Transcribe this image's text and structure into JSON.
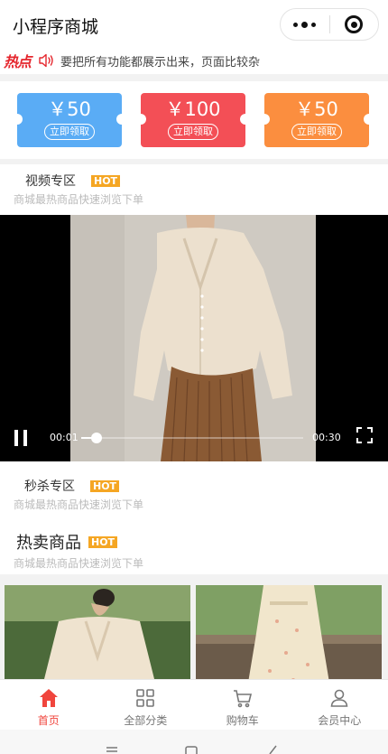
{
  "header": {
    "title": "小程序商城"
  },
  "notice": {
    "logo": "热点",
    "text": "要把所有功能都展示出来，页面比较杂"
  },
  "coupons": [
    {
      "amount": "￥50",
      "action": "立即领取",
      "color": "#5aacf5"
    },
    {
      "amount": "￥100",
      "action": "立即领取",
      "color": "#f34f56"
    },
    {
      "amount": "￥50",
      "action": "立即领取",
      "color": "#fb8e3f"
    }
  ],
  "video_section": {
    "title": "视频专区",
    "tag": "HOT",
    "subtitle": "商城最热商品快速浏览下单"
  },
  "video": {
    "current_time": "00:01",
    "duration": "00:30",
    "progress": 0.07
  },
  "seckill_section": {
    "title": "秒杀专区",
    "tag": "HOT",
    "subtitle": "商城最热商品快速浏览下单"
  },
  "hot_section": {
    "title": "热卖商品",
    "tag": "HOT",
    "subtitle": "商城最热商品快速浏览下单"
  },
  "tabbar": {
    "items": [
      {
        "label": "首页",
        "icon": "home-icon",
        "active": true
      },
      {
        "label": "全部分类",
        "icon": "grid-icon",
        "active": false
      },
      {
        "label": "购物车",
        "icon": "cart-icon",
        "active": false
      },
      {
        "label": "会员中心",
        "icon": "user-icon",
        "active": false
      }
    ]
  },
  "colors": {
    "accent": "#f0453d",
    "hot_tag": "#f5a623"
  }
}
